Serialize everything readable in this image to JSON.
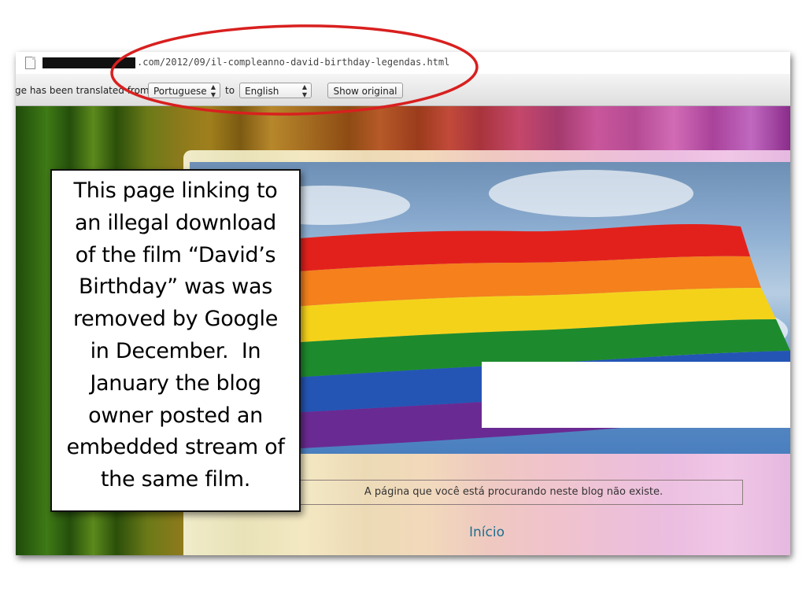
{
  "browser": {
    "url": ".com/2012/09/il-compleanno-david-birthday-legendas.html",
    "translate_bar": {
      "message": "ge has been translated from",
      "from_language": "Portuguese",
      "to_label": "to",
      "to_language": "English",
      "show_original_label": "Show original"
    }
  },
  "blog": {
    "error_message": "A página que você está procurando neste blog não existe.",
    "home_link": "Início"
  },
  "callout": {
    "lines": [
      "This page linking to",
      "an illegal download",
      "of the film “David’s",
      "Birthday” was was",
      "removed by Google",
      "in December.  In",
      "January the blog",
      "owner posted an",
      "embedded stream of",
      "the same film."
    ]
  },
  "colors": {
    "annotation_ellipse": "#d8201f",
    "link": "#1f6e8f",
    "flag": [
      "#e3211c",
      "#f5801c",
      "#f5d21a",
      "#1d8b2d",
      "#2455b5",
      "#6a2a93"
    ]
  },
  "icons": {
    "page": "document-icon",
    "select_arrows": "updown-arrows-icon"
  }
}
